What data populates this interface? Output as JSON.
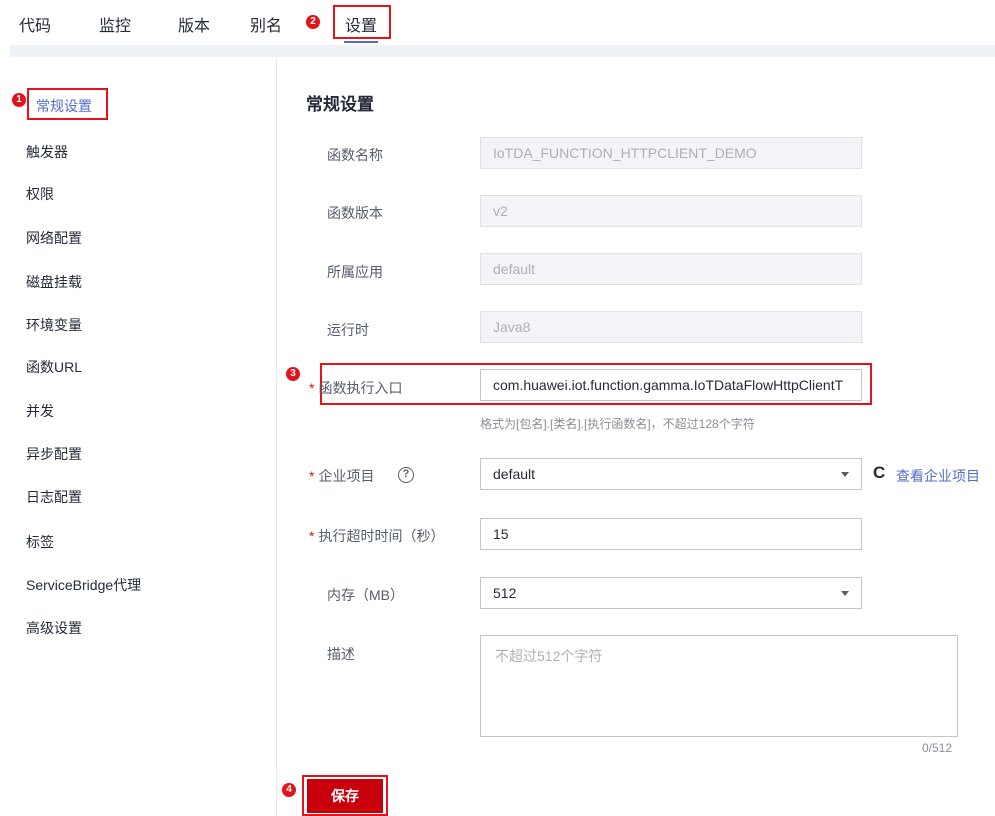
{
  "tabs": [
    {
      "label": "代码"
    },
    {
      "label": "监控"
    },
    {
      "label": "版本"
    },
    {
      "label": "别名"
    },
    {
      "label": "设置"
    }
  ],
  "annotations": [
    "1",
    "2",
    "3",
    "4"
  ],
  "sidebar": {
    "items": [
      {
        "label": "常规设置"
      },
      {
        "label": "触发器"
      },
      {
        "label": "权限"
      },
      {
        "label": "网络配置"
      },
      {
        "label": "磁盘挂载"
      },
      {
        "label": "环境变量"
      },
      {
        "label": "函数URL"
      },
      {
        "label": "并发"
      },
      {
        "label": "异步配置"
      },
      {
        "label": "日志配置"
      },
      {
        "label": "标签"
      },
      {
        "label": "ServiceBridge代理"
      },
      {
        "label": "高级设置"
      }
    ]
  },
  "main": {
    "title": "常规设置",
    "required_mark": "*",
    "function_name": {
      "label": "函数名称",
      "value": "IoTDA_FUNCTION_HTTPCLIENT_DEMO"
    },
    "function_version": {
      "label": "函数版本",
      "value": "v2"
    },
    "app": {
      "label": "所属应用",
      "value": "default"
    },
    "runtime": {
      "label": "运行时",
      "value": "Java8"
    },
    "handler": {
      "label": "函数执行入口",
      "value": "com.huawei.iot.function.gamma.IoTDataFlowHttpClientT",
      "hint": "格式为[包名].[类名].[执行函数名]，不超过128个字符"
    },
    "enterprise_project": {
      "label": "企业项目",
      "help": "?",
      "value": "default",
      "refresh_icon": "C",
      "link": "查看企业项目"
    },
    "timeout": {
      "label": "执行超时时间（秒）",
      "value": "15"
    },
    "memory": {
      "label": "内存（MB）",
      "value": "512"
    },
    "description": {
      "label": "描述",
      "placeholder": "不超过512个字符",
      "counter": "0/512"
    },
    "save_label": "保存"
  },
  "colors": {
    "accent": "#526ecc",
    "brand_red": "#c7000b",
    "annotation_red": "#e3121b"
  }
}
